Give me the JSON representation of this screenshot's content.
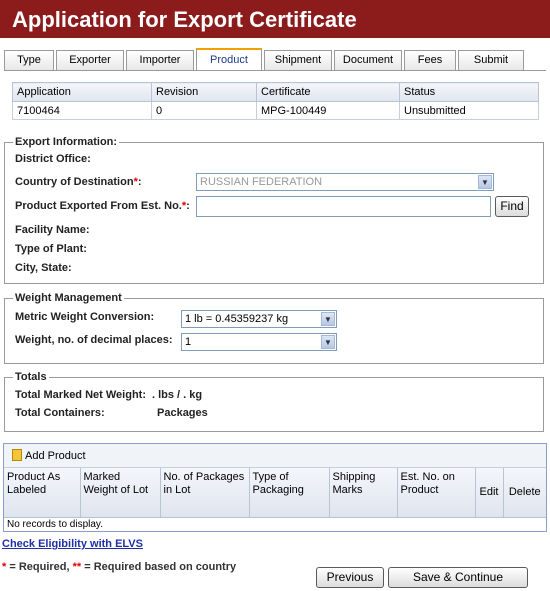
{
  "title": "Application for Export Certificate",
  "tabs": [
    {
      "label": "Type"
    },
    {
      "label": "Exporter"
    },
    {
      "label": "Importer"
    },
    {
      "label": "Product"
    },
    {
      "label": "Shipment"
    },
    {
      "label": "Document"
    },
    {
      "label": "Fees"
    },
    {
      "label": "Submit"
    }
  ],
  "info_table": {
    "headers": [
      "Application",
      "Revision",
      "Certificate",
      "Status"
    ],
    "row": [
      "7100464",
      "0",
      "MPG-100449",
      "Unsubmitted"
    ]
  },
  "export_info": {
    "legend": "Export Information:",
    "district_label": "District Office:",
    "country_label": "Country of Destination",
    "country_value": "RUSSIAN FEDERATION",
    "est_label": "Product Exported From Est. No.",
    "est_value": "",
    "find_button": "Find",
    "facility_label": "Facility Name:",
    "plant_label": "Type of Plant:",
    "city_label": "City, State:"
  },
  "weight": {
    "legend": "Weight Management",
    "metric_label": "Metric Weight Conversion:",
    "metric_value": "1 lb = 0.45359237 kg",
    "decimal_label": "Weight, no. of decimal places:",
    "decimal_value": "1"
  },
  "totals": {
    "legend": "Totals",
    "net_weight_label": "Total Marked Net Weight:",
    "net_weight_value": ". lbs / . kg",
    "containers_label": "Total Containers:",
    "containers_value": "Packages"
  },
  "grid": {
    "add_label": "Add Product",
    "columns": [
      "Product As Labeled",
      "Marked Weight of Lot",
      "No. of Packages in Lot",
      "Type of Packaging",
      "Shipping Marks",
      "Est. No. on Product",
      "Edit",
      "Delete"
    ],
    "empty_text": "No records to display."
  },
  "elvs_link": "Check Eligibility with ELVS",
  "required_note": {
    "star1": "*",
    "text1": " = Required, ",
    "star2": "**",
    "text2": " = Required based on country"
  },
  "buttons": {
    "previous": "Previous",
    "save_continue": "Save & Continue"
  },
  "colors": {
    "title_bar": "#8c1c1c",
    "active_tab_accent": "#f0a000",
    "link": "#1f2fa8",
    "required": "#d00000"
  }
}
